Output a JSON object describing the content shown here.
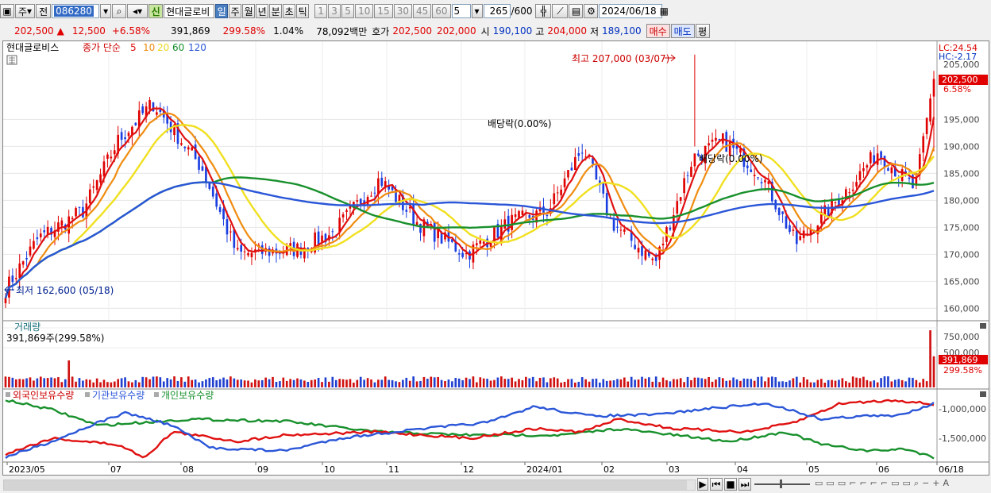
{
  "toolbar": {
    "period_type": "주",
    "prev_label": "전",
    "code": "086280",
    "badge": "신",
    "stock_name": "현대글로비",
    "periods": [
      {
        "label": "일",
        "active": true
      },
      {
        "label": "주",
        "active": false
      },
      {
        "label": "월",
        "active": false
      },
      {
        "label": "년",
        "active": false
      },
      {
        "label": "분",
        "active": false
      },
      {
        "label": "초",
        "active": false
      },
      {
        "label": "틱",
        "active": false
      }
    ],
    "intervals": [
      "1",
      "3",
      "5",
      "10",
      "15",
      "30",
      "45",
      "60"
    ],
    "interval_select": "5",
    "count": "265",
    "count_max": "/600",
    "date": "2024/06/18"
  },
  "quote": {
    "price": "202,500",
    "change_arrow": "▲",
    "change": "12,500",
    "change_pct": "+6.58%",
    "volume": "391,869",
    "volume_ratio": "299.58%",
    "turnover": "1.04%",
    "amount": "78,092백만",
    "bid_label": "호가",
    "ask": "202,500",
    "bid": "202,000",
    "open_label": "시",
    "open": "190,100",
    "high_label": "고",
    "high": "204,000",
    "low_label": "저",
    "low": "189,100",
    "buy_button": "매수",
    "sell_button": "매도",
    "eval_button": "평"
  },
  "price_panel": {
    "legend_name": "현대글로비스",
    "legend_ma": "종가 단순",
    "ma_periods": [
      "5",
      "10",
      "20",
      "60",
      "120"
    ],
    "ma_colors": [
      "#e01010",
      "#f08c10",
      "#f0e020",
      "#18902c",
      "#2a56d8"
    ],
    "lc_label": "LC:24.54",
    "hc_label": "HC:-2.17",
    "top_cut_label": "205,000",
    "current_price_tag": "202,500",
    "current_change_tag": "6.58%",
    "max_annotation": "최고 207,000 (03/07)",
    "min_annotation": "최저 162,600 (05/18)",
    "dividend_label_1": "배당락(0.00%)",
    "dividend_label_2": "배당락(0.00%)",
    "y_ticks": [
      "195,000",
      "190,000",
      "185,000",
      "180,000",
      "175,000",
      "170,000",
      "165,000",
      "160,000"
    ]
  },
  "volume_panel": {
    "title": "거래량",
    "value_text": "391,869주(299.58%)",
    "y_ticks": [
      "750,000",
      "500,000"
    ],
    "current_tag": "391,869",
    "ratio_tag": "299.58%"
  },
  "holdings_panel": {
    "legend": [
      "외국인보유수량",
      "기관보유수량",
      "개인보유수량"
    ],
    "colors": [
      "#e01010",
      "#2a56d8",
      "#18902c"
    ],
    "y_ticks": [
      "-1,000,000",
      "-1,500,000"
    ]
  },
  "x_labels": [
    "2023/05",
    "07",
    "08",
    "09",
    "10",
    "11",
    "12",
    "2024/01",
    "02",
    "03",
    "04",
    "05",
    "06",
    "06/18"
  ],
  "chart_data": {
    "type": "line",
    "x_range": [
      "2023/05/18",
      "2024/06/18"
    ],
    "ylim": [
      158000,
      208000
    ],
    "close_series_approx": {
      "x": [
        "2023/05/18",
        "2023/06/01",
        "2023/06/20",
        "2023/07/05",
        "2023/07/20",
        "2023/08/10",
        "2023/08/25",
        "2023/09/20",
        "2023/10/05",
        "2023/10/25",
        "2023/11/10",
        "2023/12/01",
        "2023/12/20",
        "2024/01/05",
        "2024/01/20",
        "2024/02/01",
        "2024/02/20",
        "2024/03/07",
        "2024/03/20",
        "2024/04/05",
        "2024/04/20",
        "2024/05/10",
        "2024/05/25",
        "2024/06/10",
        "2024/06/18"
      ],
      "y": [
        163500,
        173000,
        178000,
        191000,
        198000,
        186000,
        170000,
        171000,
        174000,
        184000,
        176000,
        170000,
        176000,
        178000,
        190000,
        176000,
        168500,
        188000,
        191000,
        185000,
        172000,
        181000,
        189000,
        182000,
        202500
      ]
    },
    "max_point": {
      "date": "03/07",
      "value": 207000
    },
    "min_point": {
      "date": "05/18",
      "value": 162600
    }
  }
}
